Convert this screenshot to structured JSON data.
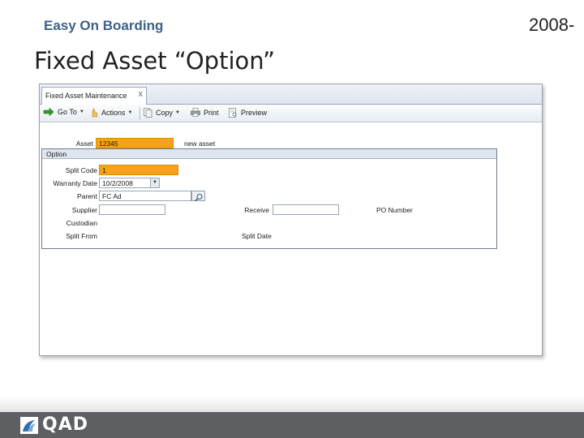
{
  "slide": {
    "kicker": "Easy On Boarding",
    "title": "Fixed Asset “Option”"
  },
  "app": {
    "tab_label": "Fixed Asset Maintenance",
    "tab_close": "x",
    "toolbar": {
      "goto": "Go To",
      "actions": "Actions",
      "copy": "Copy",
      "print": "Print",
      "preview": "Preview"
    },
    "form": {
      "asset_label": "Asset",
      "asset_value": "12345",
      "asset_description": "new asset",
      "group_title": "Option",
      "split_code_label": "Split Code",
      "split_code_value": "1",
      "warranty_date_label": "Warranty Date",
      "warranty_date_value": "10/2/2008",
      "parent_label": "Parent",
      "parent_value": "FC Ad",
      "supplier_label": "Supplier",
      "supplier_value": "",
      "receive_label": "Receive",
      "receive_value": "",
      "po_number_label": "PO Number",
      "custodian_label": "Custodian",
      "split_from_label": "Split From",
      "split_date_label": "Split Date"
    }
  },
  "footer": {
    "brand": "QAD",
    "year": "2008-"
  },
  "colors": {
    "highlight_field": "#f7a21b",
    "footer_bar": "#5d5f63",
    "kicker_text": "#3f6185"
  },
  "icons": {
    "goto": "green-arrow-icon",
    "actions": "pointing-hand-icon",
    "copy": "document-copy-icon",
    "print": "printer-icon",
    "preview": "preview-document-icon",
    "parent_lookup": "magnifier-icon",
    "logo": "qad-logo-icon"
  }
}
